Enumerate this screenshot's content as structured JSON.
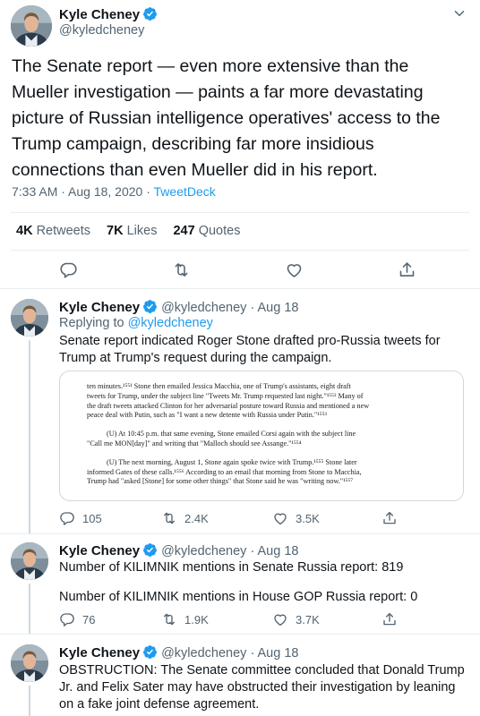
{
  "main_tweet": {
    "name": "Kyle Cheney",
    "handle": "@kyledcheney",
    "text": "The Senate report — even more extensive than the Mueller investigation — paints a far more devastating picture of Russian intelligence operatives' access to the Trump campaign, describing far more insidious connections than even Mueller did in his report.",
    "time": "7:33 AM · Aug 18, 2020 · ",
    "source": "TweetDeck",
    "retweets_count": "4K",
    "retweets_label": "Retweets",
    "likes_count": "7K",
    "likes_label": "Likes",
    "quotes_count": "247",
    "quotes_label": "Quotes"
  },
  "replies": [
    {
      "name": "Kyle Cheney",
      "handle": "@kyledcheney",
      "date": "· Aug 18",
      "replying_prefix": "Replying to ",
      "replying_handle": "@kyledcheney",
      "text": "Senate report indicated Roger Stone drafted pro-Russia tweets for Trump at Trump's request during the campaign.",
      "replies": "105",
      "retweets": "2.4K",
      "likes": "3.5K",
      "doc_lines": [
        "ten minutes.¹⁵⁵¹ Stone then emailed Jessica Macchia, one of Trump's assistants, eight draft",
        "tweets for Trump, under the subject line \"Tweets Mr. Trump requested last night.\"¹⁵⁵² Many of",
        "the draft tweets attacked Clinton for her adversarial posture toward Russia and mentioned a new",
        "peace deal with Putin, such as \"I want a new detente with Russia under Putin.\"¹⁵⁵³",
        "(U) At 10:45 p.m. that same evening, Stone emailed Corsi again with the subject line",
        "\"Call me MON[day]\" and writing that \"Malloch should see Assange.\"¹⁵⁵⁴",
        "(U) The next morning, August 1, Stone again spoke twice with Trump.¹⁵⁵⁵ Stone later",
        "informed Gates of these calls.¹⁵⁵⁶ According to an email that morning from Stone to Macchia,",
        "Trump had \"asked [Stone] for some other things\" that Stone said he was \"writing now.\"¹⁵⁵⁷"
      ]
    },
    {
      "name": "Kyle Cheney",
      "handle": "@kyledcheney",
      "date": "· Aug 18",
      "text_line1": "Number of KILIMNIK mentions in Senate Russia report: 819",
      "text_line2": "Number of KILIMNIK mentions in House GOP Russia report: 0",
      "replies": "76",
      "retweets": "1.9K",
      "likes": "3.7K"
    },
    {
      "name": "Kyle Cheney",
      "handle": "@kyledcheney",
      "date": "· Aug 18",
      "text": "OBSTRUCTION: The Senate committee concluded that Donald Trump Jr. and Felix Sater may have obstructed their investigation by leaning on a fake joint defense agreement."
    }
  ],
  "icons": {
    "verified": "verified-badge-icon",
    "more": "more-chevron-icon",
    "reply": "reply-icon",
    "retweet": "retweet-icon",
    "like": "heart-icon",
    "share": "share-icon"
  },
  "colors": {
    "accent": "#1d9bf0",
    "text": "#0f1419",
    "secondary": "#536471",
    "divider": "#e6ecf0"
  }
}
